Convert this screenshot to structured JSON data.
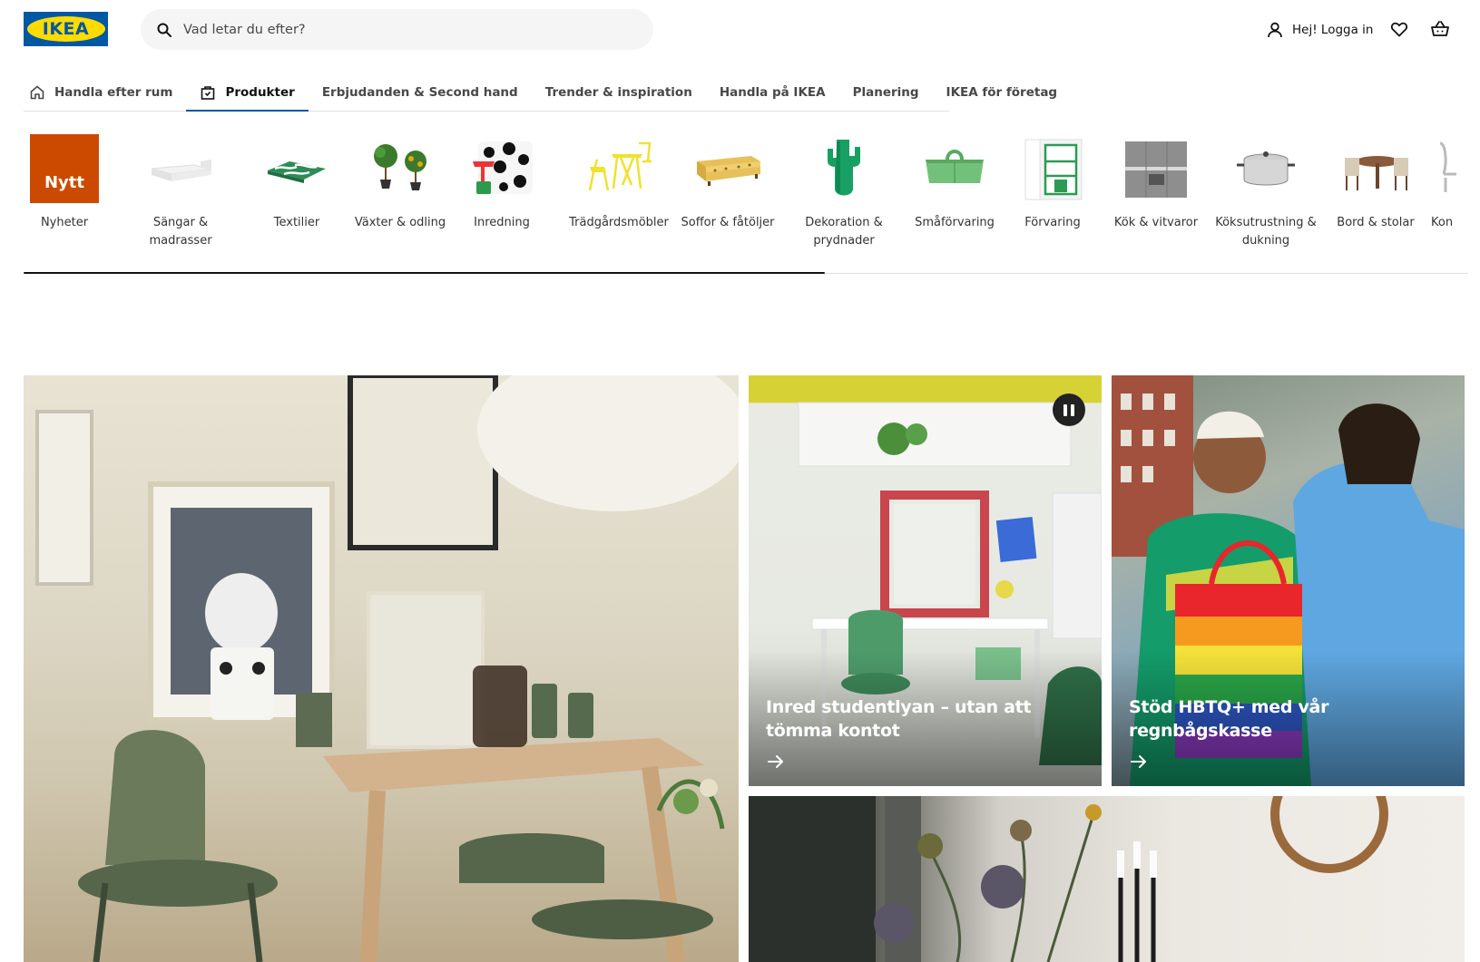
{
  "header": {
    "logo_text": "IKEA",
    "search_placeholder": "Vad letar du efter?",
    "login_label": "Hej! Logga in",
    "icons": [
      "search-icon",
      "user-icon",
      "heart-icon",
      "basket-icon"
    ]
  },
  "tabs": [
    {
      "label": "Handla efter rum",
      "icon": "home-icon"
    },
    {
      "label": "Produkter",
      "icon": "bag-icon",
      "active": true
    },
    {
      "label": "Erbjudanden & Second hand"
    },
    {
      "label": "Trender & inspiration"
    },
    {
      "label": "Handla på IKEA"
    },
    {
      "label": "Planering"
    },
    {
      "label": "IKEA för företag"
    }
  ],
  "categories": [
    {
      "label": "Nyheter",
      "badge": "Nytt"
    },
    {
      "label": "Sängar & madrasser"
    },
    {
      "label": "Textilier"
    },
    {
      "label": "Växter & odling"
    },
    {
      "label": "Inredning"
    },
    {
      "label": "Trädgårdsmöbler"
    },
    {
      "label": "Soffor & fåtöljer"
    },
    {
      "label": "Dekoration & prydnader"
    },
    {
      "label": "Småförvaring"
    },
    {
      "label": "Förvaring"
    },
    {
      "label": "Kök & vitvaror"
    },
    {
      "label": "Köksutrustning & dukning"
    },
    {
      "label": "Bord & stolar"
    },
    {
      "label": "Kon"
    }
  ],
  "cards": {
    "study": {
      "title": "Inred studentlyan – utan att tömma kontot"
    },
    "pride": {
      "title": "Stöd HBTQ+ med vår regnbågskasse"
    }
  },
  "colors": {
    "ikea_blue": "#0058a3",
    "ikea_yellow": "#ffdb00",
    "nytt_orange": "#cc4a00"
  }
}
